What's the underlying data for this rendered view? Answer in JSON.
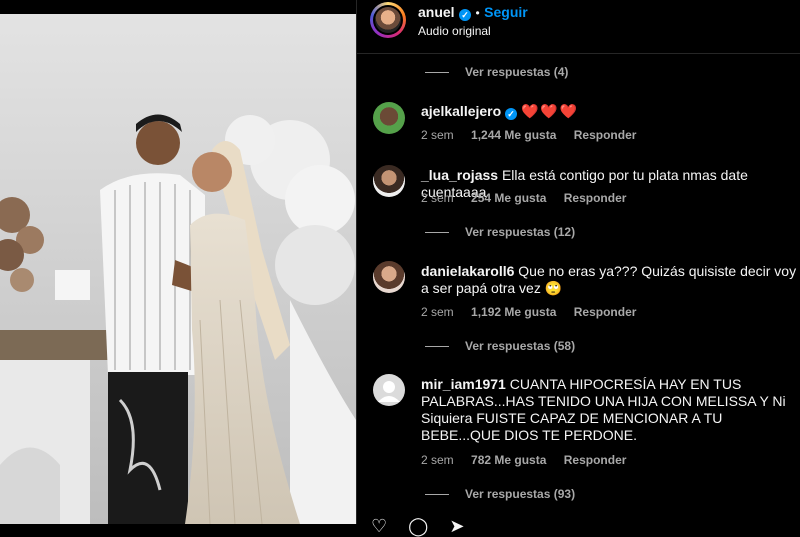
{
  "post": {
    "username": "anuel",
    "follow_label": "Seguir",
    "dot": "•",
    "audio": "Audio original"
  },
  "comments": [
    {
      "type": "replies",
      "label": "Ver respuestas (4)"
    },
    {
      "type": "comment",
      "username": "ajelkallejero",
      "verified": true,
      "text": "❤️❤️❤️",
      "time": "2 sem",
      "likes": "1,244 Me gusta",
      "reply": "Responder"
    },
    {
      "type": "comment",
      "username": "_lua_rojass",
      "text": "Ella está contigo por tu plata nmas date cuentaaaa",
      "time": "2 sem",
      "likes": "254 Me gusta",
      "reply": "Responder"
    },
    {
      "type": "replies",
      "label": "Ver respuestas (12)"
    },
    {
      "type": "comment",
      "username": "danielakaroll6",
      "text": "Que no eras ya??? Quizás quisiste decir voy a ser papá otra vez 🙄",
      "time": "2 sem",
      "likes": "1,192 Me gusta",
      "reply": "Responder"
    },
    {
      "type": "replies",
      "label": "Ver respuestas (58)"
    },
    {
      "type": "comment",
      "username": "mir_iam1971",
      "text": "CUANTA HIPOCRESÍA HAY EN TUS PALABRAS...HAS TENIDO UNA HIJA CON MELISSA Y Ni Siquiera FUISTE CAPAZ DE MENCIONAR A TU BEBE...QUE DIOS TE PERDONE.",
      "time": "2 sem",
      "likes": "782 Me gusta",
      "reply": "Responder"
    },
    {
      "type": "replies",
      "label": "Ver respuestas (93)"
    }
  ],
  "colors": {
    "background": "#000000",
    "accent": "#0095f6",
    "muted": "#a8a8a8",
    "heart": "#ff3040"
  },
  "icons": [
    "heart-icon",
    "comment-icon",
    "share-icon"
  ]
}
